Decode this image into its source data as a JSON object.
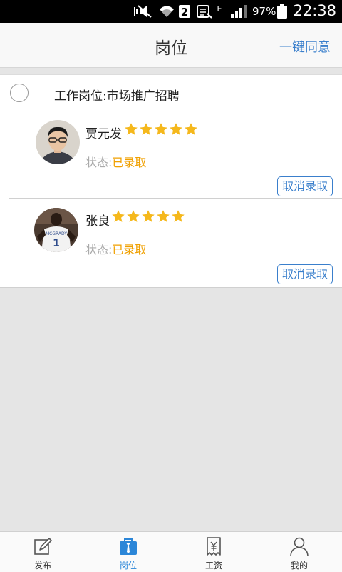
{
  "status_bar": {
    "network_type": "E",
    "sim_slot": "2",
    "battery": "97%",
    "time": "22:38"
  },
  "header": {
    "title": "岗位",
    "action": "一键同意"
  },
  "job": {
    "label": "工作岗位:市场推广招聘"
  },
  "candidates": [
    {
      "name": "贾元发",
      "rating": 5,
      "status_label": "状态:",
      "status_value": "已录取",
      "button": "取消录取"
    },
    {
      "name": "张良",
      "rating": 5,
      "status_label": "状态:",
      "status_value": "已录取",
      "button": "取消录取"
    }
  ],
  "nav": {
    "tabs": [
      {
        "label": "发布",
        "icon": "edit-icon"
      },
      {
        "label": "岗位",
        "icon": "briefcase-icon"
      },
      {
        "label": "工资",
        "icon": "receipt-yen-icon"
      },
      {
        "label": "我的",
        "icon": "person-icon"
      }
    ],
    "active_tab": "岗位"
  },
  "colors": {
    "accent": "#3a7fcc",
    "active_tab": "#2b86d8",
    "status_accepted": "#f0a000",
    "star": "#f5b81c"
  }
}
